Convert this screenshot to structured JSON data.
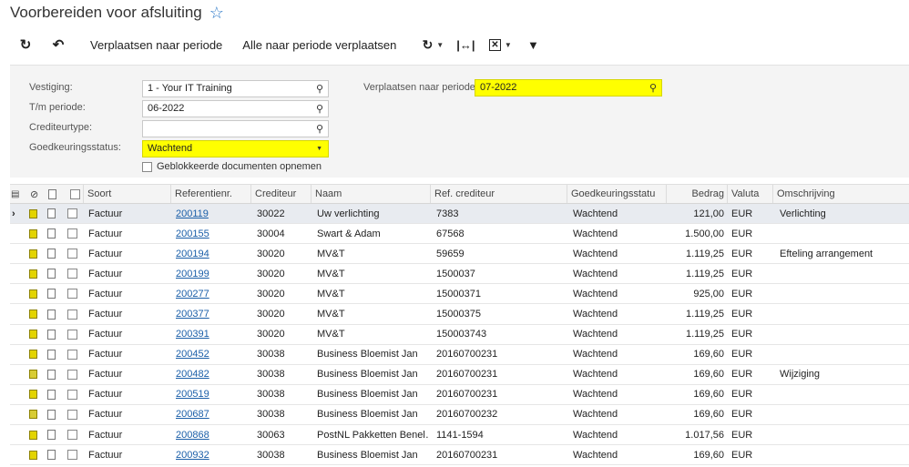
{
  "page": {
    "title": "Voorbereiden voor afsluiting"
  },
  "toolbar": {
    "move_to_period": "Verplaatsen naar periode",
    "move_all": "Alle naar periode verplaatsen"
  },
  "form": {
    "branch": {
      "label": "Vestiging:",
      "value": "1 - Your IT Training"
    },
    "until_period": {
      "label": "T/m periode:",
      "value": "06-2022"
    },
    "creditor_type": {
      "label": "Crediteurtype:",
      "value": ""
    },
    "approval_status": {
      "label": "Goedkeuringsstatus:",
      "value": "Wachtend"
    },
    "include_blocked": {
      "label": "Geblokkeerde documenten opnemen"
    },
    "move_to_period": {
      "label": "Verplaatsen naar periode:",
      "value": "07-2022"
    }
  },
  "grid": {
    "headers": {
      "type": "Soort",
      "ref": "Referentienr.",
      "creditor": "Crediteur",
      "name": "Naam",
      "ref_creditor": "Ref. crediteur",
      "status": "Goedkeuringsstatu",
      "amount": "Bedrag",
      "currency": "Valuta",
      "description": "Omschrijving"
    },
    "rows": [
      {
        "type": "Factuur",
        "ref": "200119",
        "creditor": "30022",
        "name": "Uw verlichting",
        "ref_creditor": "7383",
        "status": "Wachtend",
        "amount": "121,00",
        "currency": "EUR",
        "description": "Verlichting"
      },
      {
        "type": "Factuur",
        "ref": "200155",
        "creditor": "30004",
        "name": "Swart & Adam",
        "ref_creditor": "67568",
        "status": "Wachtend",
        "amount": "1.500,00",
        "currency": "EUR",
        "description": ""
      },
      {
        "type": "Factuur",
        "ref": "200194",
        "creditor": "30020",
        "name": "MV&T",
        "ref_creditor": "59659",
        "status": "Wachtend",
        "amount": "1.119,25",
        "currency": "EUR",
        "description": "Efteling arrangement"
      },
      {
        "type": "Factuur",
        "ref": "200199",
        "creditor": "30020",
        "name": "MV&T",
        "ref_creditor": "1500037",
        "status": "Wachtend",
        "amount": "1.119,25",
        "currency": "EUR",
        "description": ""
      },
      {
        "type": "Factuur",
        "ref": "200277",
        "creditor": "30020",
        "name": "MV&T",
        "ref_creditor": "15000371",
        "status": "Wachtend",
        "amount": "925,00",
        "currency": "EUR",
        "description": ""
      },
      {
        "type": "Factuur",
        "ref": "200377",
        "creditor": "30020",
        "name": "MV&T",
        "ref_creditor": "15000375",
        "status": "Wachtend",
        "amount": "1.119,25",
        "currency": "EUR",
        "description": ""
      },
      {
        "type": "Factuur",
        "ref": "200391",
        "creditor": "30020",
        "name": "MV&T",
        "ref_creditor": "150003743",
        "status": "Wachtend",
        "amount": "1.119,25",
        "currency": "EUR",
        "description": ""
      },
      {
        "type": "Factuur",
        "ref": "200452",
        "creditor": "30038",
        "name": "Business Bloemist Jan",
        "ref_creditor": "20160700231",
        "status": "Wachtend",
        "amount": "169,60",
        "currency": "EUR",
        "description": ""
      },
      {
        "type": "Factuur",
        "ref": "200482",
        "creditor": "30038",
        "name": "Business Bloemist Jan",
        "ref_creditor": "20160700231",
        "status": "Wachtend",
        "amount": "169,60",
        "currency": "EUR",
        "description": "Wijziging"
      },
      {
        "type": "Factuur",
        "ref": "200519",
        "creditor": "30038",
        "name": "Business Bloemist Jan",
        "ref_creditor": "20160700231",
        "status": "Wachtend",
        "amount": "169,60",
        "currency": "EUR",
        "description": ""
      },
      {
        "type": "Factuur",
        "ref": "200687",
        "creditor": "30038",
        "name": "Business Bloemist Jan",
        "ref_creditor": "20160700232",
        "status": "Wachtend",
        "amount": "169,60",
        "currency": "EUR",
        "description": ""
      },
      {
        "type": "Factuur",
        "ref": "200868",
        "creditor": "30063",
        "name": "PostNL Pakketten Benel…",
        "ref_creditor": "1141-1594",
        "status": "Wachtend",
        "amount": "1.017,56",
        "currency": "EUR",
        "description": ""
      },
      {
        "type": "Factuur",
        "ref": "200932",
        "creditor": "30038",
        "name": "Business Bloemist Jan",
        "ref_creditor": "20160700231",
        "status": "Wachtend",
        "amount": "169,60",
        "currency": "EUR",
        "description": ""
      }
    ]
  }
}
